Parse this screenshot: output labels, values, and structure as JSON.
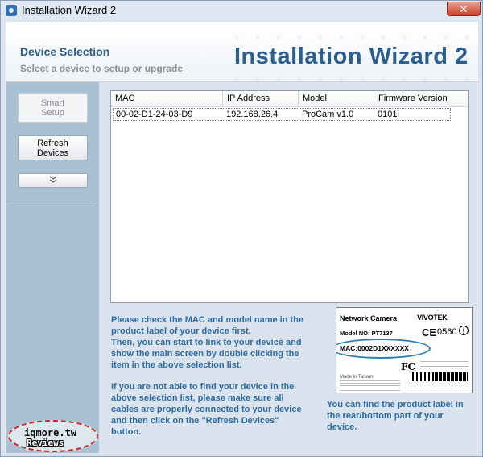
{
  "window": {
    "title": "Installation Wizard 2",
    "close_glyph": "✕"
  },
  "header": {
    "heading": "Device Selection",
    "subheading": "Select a device to setup or upgrade",
    "brand_title": "Installation Wizard 2"
  },
  "sidebar": {
    "smart_setup": "Smart Setup",
    "refresh_devices": "Refresh Devices",
    "expand_glyph": "⌄⌄"
  },
  "device_list": {
    "columns": [
      "MAC",
      "IP Address",
      "Model",
      "Firmware Version"
    ],
    "rows": [
      {
        "mac": "00-02-D1-24-03-D9",
        "ip": "192.168.26.4",
        "model": "ProCam v1.0",
        "firmware": "0101i"
      }
    ]
  },
  "instructions": {
    "para1": [
      "Please check the MAC and model name in the",
      "product label of your device first.",
      "Then, you can start to link to your device and",
      "show the main screen by double clicking the",
      "item in the above selection list."
    ],
    "para2": [
      "If you are not able to find your device in the",
      "above selection list, please make sure all",
      "cables are properly connected to your device",
      "and then click on the \"Refresh Devices\"",
      "button."
    ]
  },
  "product_label": {
    "title": "Network Camera",
    "brand": "VIVOTEK",
    "model": "Model NO: PT7137",
    "ce_mark": "CE",
    "cert_number": "0560",
    "alert_mark": "!",
    "mac": "MAC:0002D1XXXXXX",
    "fc_mark": "FC",
    "made_in": "Made in Taiwan",
    "caption": [
      "You can find the product label in",
      "the rear/bottom part of your",
      "device."
    ]
  },
  "watermark": {
    "line1": "iqmore.tw",
    "line2": "Reviews"
  },
  "colors": {
    "accent_blue": "#2c6ba4",
    "sidebar": "#a8c2d4",
    "highlight_oval": "#2a7fb0"
  }
}
